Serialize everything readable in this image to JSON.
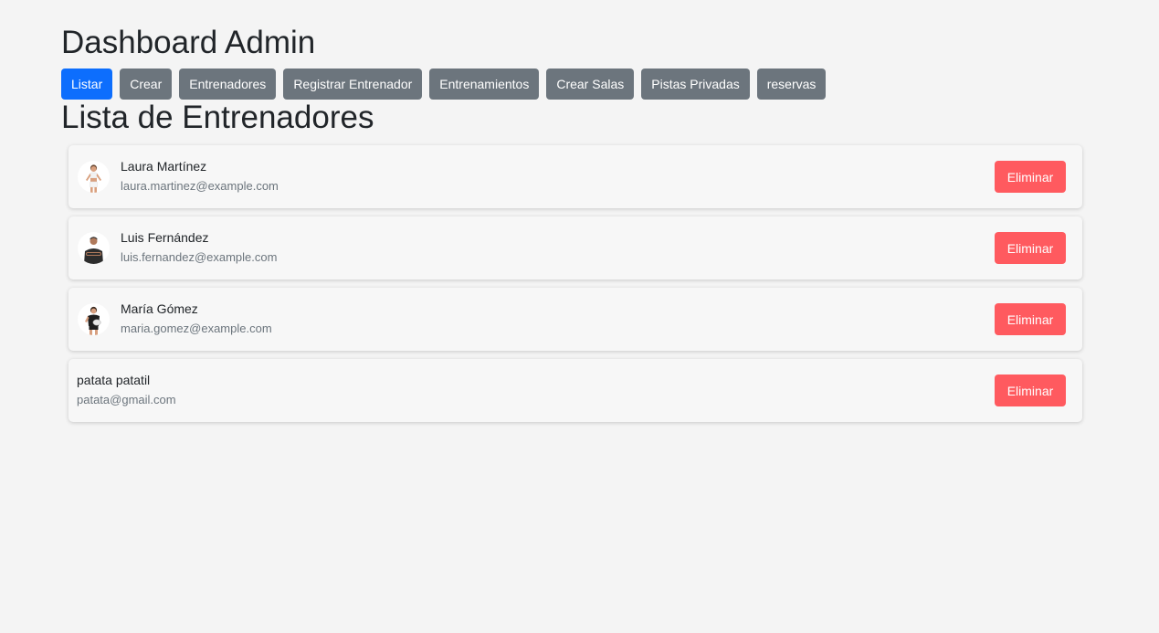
{
  "header": {
    "title": "Dashboard Admin"
  },
  "nav": {
    "items": [
      {
        "label": "Listar",
        "active": true
      },
      {
        "label": "Crear",
        "active": false
      },
      {
        "label": "Entrenadores",
        "active": false
      },
      {
        "label": "Registrar Entrenador",
        "active": false
      },
      {
        "label": "Entrenamientos",
        "active": false
      },
      {
        "label": "Crear Salas",
        "active": false
      },
      {
        "label": "Pistas Privadas",
        "active": false
      },
      {
        "label": "reservas",
        "active": false
      }
    ]
  },
  "section": {
    "title": "Lista de Entrenadores"
  },
  "trainers": [
    {
      "name": "Laura Martínez",
      "email": "laura.martinez@example.com",
      "has_avatar": true,
      "delete_label": "Eliminar"
    },
    {
      "name": "Luis Fernández",
      "email": "luis.fernandez@example.com",
      "has_avatar": true,
      "delete_label": "Eliminar"
    },
    {
      "name": "María Gómez",
      "email": "maria.gomez@example.com",
      "has_avatar": true,
      "delete_label": "Eliminar"
    },
    {
      "name": "patata patatil",
      "email": "patata@gmail.com",
      "has_avatar": false,
      "delete_label": "Eliminar"
    }
  ],
  "colors": {
    "background": "#f4f4f4",
    "primary": "#0d6efd",
    "secondary": "#6c757d",
    "danger": "#ff5a5f"
  }
}
